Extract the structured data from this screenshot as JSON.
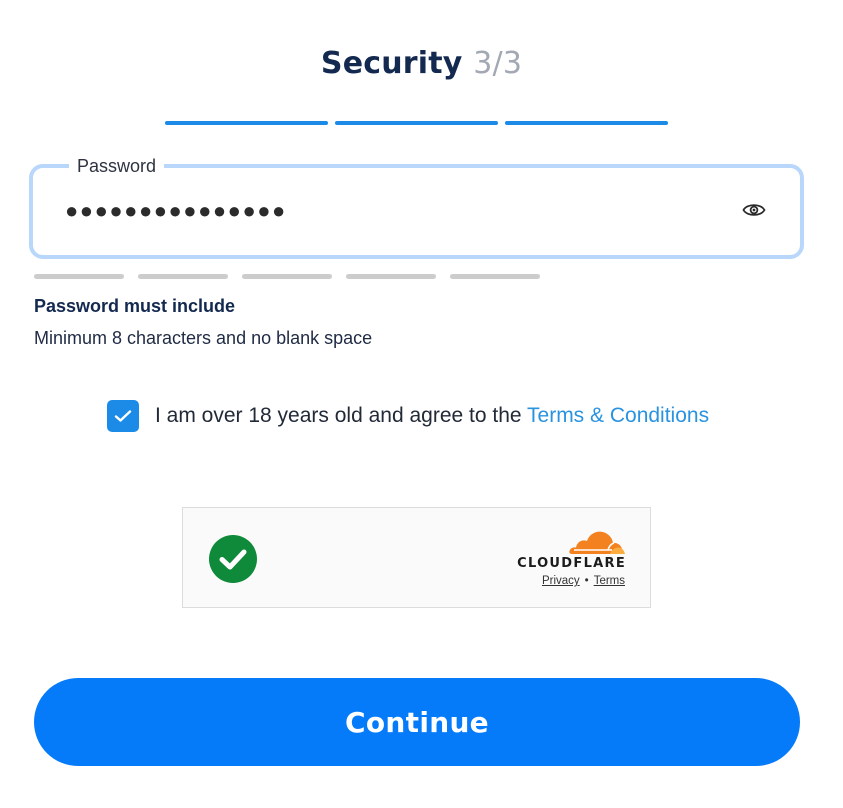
{
  "header": {
    "title": "Security",
    "step": "3/3"
  },
  "steps": {
    "total": 3,
    "completed": 3
  },
  "password": {
    "label": "Password",
    "value_masked": "●●●●●●●●●●●●●●●",
    "toggle_icon": "eye-icon"
  },
  "strength": {
    "segments": 5,
    "filled": 0
  },
  "rules": {
    "title": "Password must include",
    "text": "Minimum 8 characters and no blank space"
  },
  "terms": {
    "checked": true,
    "text": "I am over 18 years old and agree to the ",
    "link": "Terms & Conditions"
  },
  "captcha": {
    "status_icon": "success-check-icon",
    "brand": "CLOUDFLARE",
    "privacy": "Privacy",
    "separator": "•",
    "terms": "Terms"
  },
  "actions": {
    "continue_label": "Continue"
  },
  "colors": {
    "accent": "#1c8be8",
    "button": "#067bf9",
    "title": "#14294f",
    "success": "#0e8a3a",
    "cloudflare_orange": "#f48120"
  }
}
